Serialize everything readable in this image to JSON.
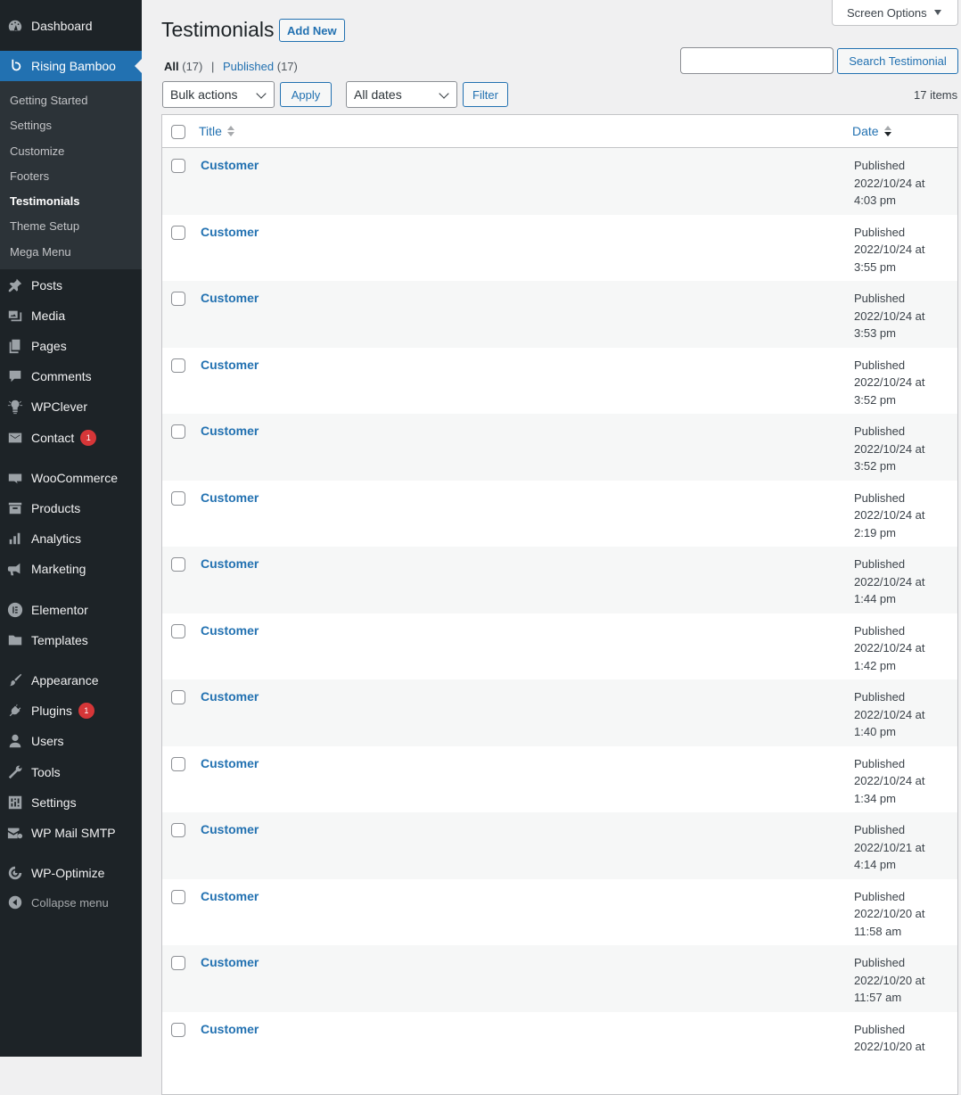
{
  "sidebar": {
    "top_items": [
      {
        "label": "Dashboard",
        "icon": "dashboard-icon"
      },
      {
        "label": "Rising Bamboo",
        "icon": "bamboo-icon"
      }
    ],
    "submenu": [
      {
        "label": "Getting Started"
      },
      {
        "label": "Settings"
      },
      {
        "label": "Customize"
      },
      {
        "label": "Footers"
      },
      {
        "label": "Testimonials"
      },
      {
        "label": "Theme Setup"
      },
      {
        "label": "Mega Menu"
      }
    ],
    "items": [
      {
        "label": "Posts",
        "icon": "pin-icon"
      },
      {
        "label": "Media",
        "icon": "media-icon"
      },
      {
        "label": "Pages",
        "icon": "pages-icon"
      },
      {
        "label": "Comments",
        "icon": "comments-icon"
      },
      {
        "label": "WPClever",
        "icon": "bulb-icon"
      },
      {
        "label": "Contact",
        "icon": "mail-icon",
        "badge": "1"
      },
      {
        "label": "WooCommerce",
        "icon": "woo-icon"
      },
      {
        "label": "Products",
        "icon": "archive-icon"
      },
      {
        "label": "Analytics",
        "icon": "chart-bar-icon"
      },
      {
        "label": "Marketing",
        "icon": "megaphone-icon"
      },
      {
        "label": "Elementor",
        "icon": "elementor-icon"
      },
      {
        "label": "Templates",
        "icon": "folder-icon"
      },
      {
        "label": "Appearance",
        "icon": "brush-icon"
      },
      {
        "label": "Plugins",
        "icon": "plugin-icon",
        "badge": "1"
      },
      {
        "label": "Users",
        "icon": "user-icon"
      },
      {
        "label": "Tools",
        "icon": "wrench-icon"
      },
      {
        "label": "Settings",
        "icon": "settings-sliders-icon"
      },
      {
        "label": "WP Mail SMTP",
        "icon": "mail-gear-icon"
      },
      {
        "label": "WP-Optimize",
        "icon": "optimize-icon"
      },
      {
        "label": "Collapse menu",
        "icon": "collapse-icon"
      }
    ]
  },
  "header": {
    "title": "Testimonials",
    "add_new": "Add New",
    "screen_options": "Screen Options"
  },
  "views": {
    "all_label": "All",
    "all_count": "(17)",
    "separator": "|",
    "published_label": "Published",
    "published_count": "(17)"
  },
  "search": {
    "button": "Search Testimonial",
    "value": ""
  },
  "filters": {
    "bulk_actions": "Bulk actions",
    "apply": "Apply",
    "dates": "All dates",
    "filter": "Filter",
    "items_count": "17 items"
  },
  "table": {
    "columns": {
      "title": "Title",
      "date": "Date"
    },
    "rows": [
      {
        "title": "Customer",
        "status": "Published",
        "date": "2022/10/24 at",
        "time": "4:03 pm"
      },
      {
        "title": "Customer",
        "status": "Published",
        "date": "2022/10/24 at",
        "time": "3:55 pm"
      },
      {
        "title": "Customer",
        "status": "Published",
        "date": "2022/10/24 at",
        "time": "3:53 pm"
      },
      {
        "title": "Customer",
        "status": "Published",
        "date": "2022/10/24 at",
        "time": "3:52 pm"
      },
      {
        "title": "Customer",
        "status": "Published",
        "date": "2022/10/24 at",
        "time": "3:52 pm"
      },
      {
        "title": "Customer",
        "status": "Published",
        "date": "2022/10/24 at",
        "time": "2:19 pm"
      },
      {
        "title": "Customer",
        "status": "Published",
        "date": "2022/10/24 at",
        "time": "1:44 pm"
      },
      {
        "title": "Customer",
        "status": "Published",
        "date": "2022/10/24 at",
        "time": "1:42 pm"
      },
      {
        "title": "Customer",
        "status": "Published",
        "date": "2022/10/24 at",
        "time": "1:40 pm"
      },
      {
        "title": "Customer",
        "status": "Published",
        "date": "2022/10/24 at",
        "time": "1:34 pm"
      },
      {
        "title": "Customer",
        "status": "Published",
        "date": "2022/10/21 at",
        "time": "4:14 pm"
      },
      {
        "title": "Customer",
        "status": "Published",
        "date": "2022/10/20 at",
        "time": "11:58 am"
      },
      {
        "title": "Customer",
        "status": "Published",
        "date": "2022/10/20 at",
        "time": "11:57 am"
      },
      {
        "title": "Customer",
        "status": "Published",
        "date": "2022/10/20 at",
        "time": ""
      }
    ]
  },
  "colors": {
    "accent": "#2271b1",
    "sidebar_bg": "#1d2327",
    "badge": "#d63638"
  }
}
